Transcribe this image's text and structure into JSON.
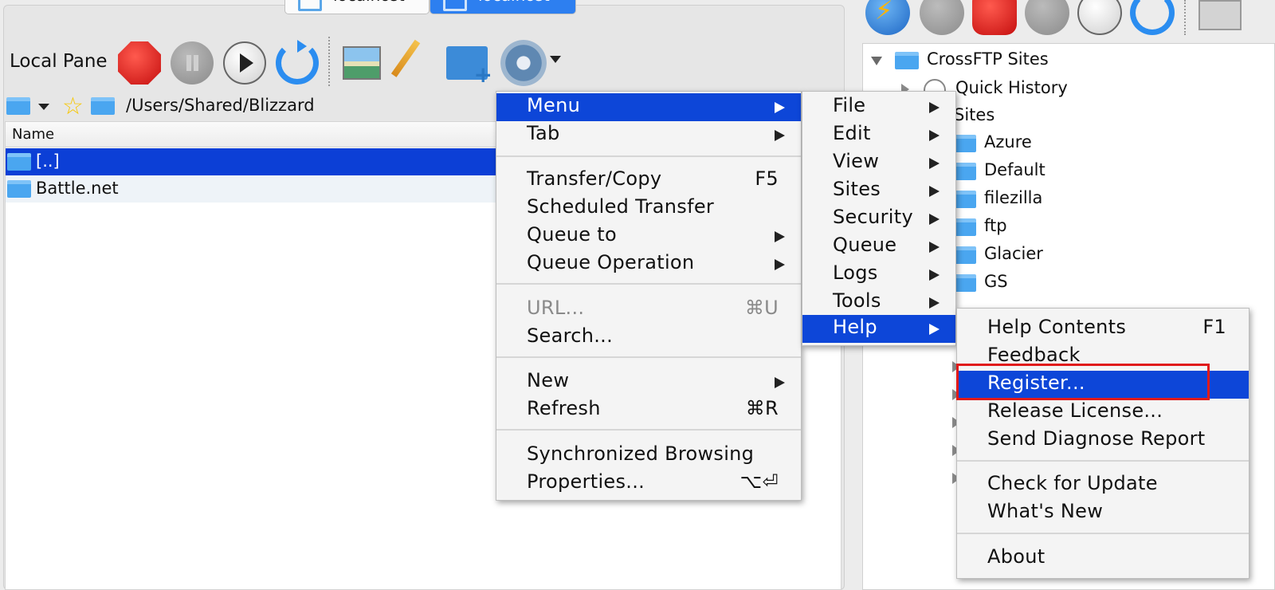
{
  "tabs": [
    {
      "label": "localhost"
    },
    {
      "label": "localhost"
    }
  ],
  "local_pane": {
    "label": "Local Pane",
    "path": "/Users/Shared/Blizzard",
    "column_name": "Name",
    "files": [
      "[..]",
      "Battle.net"
    ]
  },
  "site_tree": {
    "root": "CrossFTP Sites",
    "quick_history": "Quick History",
    "sites": "Sites",
    "children": [
      "Azure",
      "Default",
      "filezilla",
      "ftp",
      "Glacier",
      "GS"
    ]
  },
  "main_menu": {
    "items": [
      {
        "label": "Menu"
      },
      {
        "label": "Tab"
      },
      {
        "label": "Transfer/Copy",
        "shortcut": "F5"
      },
      {
        "label": "Scheduled Transfer"
      },
      {
        "label": "Queue to"
      },
      {
        "label": "Queue Operation"
      },
      {
        "label": "URL...",
        "shortcut": "⌘U"
      },
      {
        "label": "Search..."
      },
      {
        "label": "New"
      },
      {
        "label": "Refresh",
        "shortcut": "⌘R"
      },
      {
        "label": "Synchronized Browsing"
      },
      {
        "label": "Properties...",
        "shortcut": "⌥⏎"
      }
    ]
  },
  "menu_submenu": {
    "items": [
      {
        "label": "File"
      },
      {
        "label": "Edit"
      },
      {
        "label": "View"
      },
      {
        "label": "Sites"
      },
      {
        "label": "Security"
      },
      {
        "label": "Queue"
      },
      {
        "label": "Logs"
      },
      {
        "label": "Tools"
      },
      {
        "label": "Help"
      }
    ]
  },
  "help_submenu": {
    "items": [
      {
        "label": "Help Contents",
        "shortcut": "F1"
      },
      {
        "label": "Feedback"
      },
      {
        "label": "Register..."
      },
      {
        "label": "Release License..."
      },
      {
        "label": "Send Diagnose Report"
      },
      {
        "label": "Check for Update"
      },
      {
        "label": "What's New"
      },
      {
        "label": "About"
      }
    ]
  },
  "icons": {
    "stop": "stop-icon",
    "pause": "pause-icon",
    "play": "play-icon",
    "refresh": "refresh-icon",
    "image": "image-viewer-icon",
    "edit": "pencil-icon",
    "new_folder": "new-folder-icon",
    "settings": "gear-icon",
    "connect": "lightning-icon",
    "disconnect": "disconnect-icon",
    "bookmark": "star-icon",
    "folder": "folder-icon"
  },
  "colors": {
    "selection": "#0d46d8",
    "highlight_box": "#e01a1a",
    "active_tab": "#2d7ff0"
  }
}
